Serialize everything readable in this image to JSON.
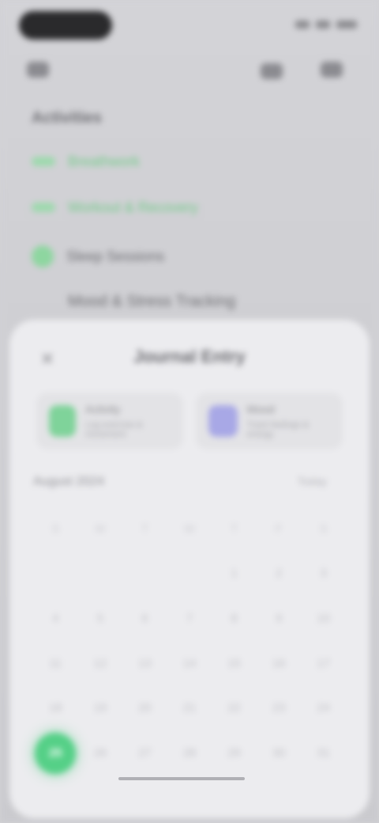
{
  "header": {
    "section_title": "Activities",
    "rows": [
      "Breathwork",
      "Workout & Recovery",
      "Sleep Sessions",
      "Mood & Stress Tracking"
    ]
  },
  "sheet": {
    "title": "Journal Entry",
    "close_icon": "close-icon",
    "cards": [
      {
        "icon": "activity-icon",
        "title": "Activity",
        "subtitle": "Log exercise & movement",
        "color": "#7fd39a"
      },
      {
        "icon": "mood-icon",
        "title": "Mood",
        "subtitle": "Track feelings & energy",
        "color": "#a8a8e6"
      }
    ],
    "calendar_label": "August 2024",
    "calendar_hint": "Today",
    "weekdays": [
      "S",
      "M",
      "T",
      "W",
      "T",
      "F",
      "S"
    ],
    "days": [
      "",
      "",
      "",
      "",
      "1",
      "2",
      "3",
      "4",
      "5",
      "6",
      "7",
      "8",
      "9",
      "10",
      "11",
      "12",
      "13",
      "14",
      "15",
      "16",
      "17",
      "18",
      "19",
      "20",
      "21",
      "22",
      "23",
      "24",
      "25",
      "26",
      "27",
      "28",
      "29",
      "30",
      "31"
    ],
    "selected_day": "25"
  },
  "colors": {
    "accent": "#55d087",
    "accent_light": "#8ed6a0",
    "secondary": "#a8a8e6"
  }
}
